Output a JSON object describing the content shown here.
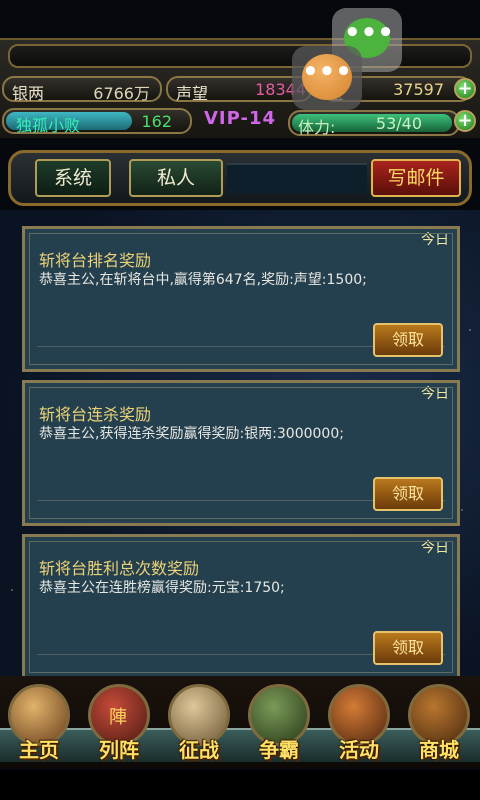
{
  "stats": {
    "silver": {
      "label": "银两",
      "value": "6766万"
    },
    "fame": {
      "label": "声望",
      "value": "18344"
    },
    "gold": {
      "label": "宝",
      "value": "37597"
    },
    "player": {
      "name": "独孤小败",
      "level": "162"
    },
    "vip": "VIP-14",
    "stamina": {
      "label": "体力:",
      "value": "53/40"
    }
  },
  "tabs": {
    "system": "系统",
    "private": "私人",
    "write": "写邮件"
  },
  "mails": [
    {
      "date": "今日",
      "title": "斩将台排名奖励",
      "body": "恭喜主公,在斩将台中,赢得第647名,奖励:声望:1500;",
      "button": "领取"
    },
    {
      "date": "今日",
      "title": "斩将台连杀奖励",
      "body": "恭喜主公,获得连杀奖励赢得奖励:银两:3000000;",
      "button": "领取"
    },
    {
      "date": "今日",
      "title": "斩将台胜利总次数奖励",
      "body": "恭喜主公在连胜榜赢得奖励:元宝:1750;",
      "button": "领取"
    }
  ],
  "nav": [
    {
      "label": "主页",
      "icon": "palace-icon"
    },
    {
      "label": "列阵",
      "icon": "banner-icon",
      "icon_text": "陣"
    },
    {
      "label": "征战",
      "icon": "map-scroll-icon"
    },
    {
      "label": "争霸",
      "icon": "crossed-axes-icon"
    },
    {
      "label": "活动",
      "icon": "lantern-icon"
    },
    {
      "label": "商城",
      "icon": "treasure-chest-icon"
    }
  ],
  "chat": {
    "green_icon": "message-icon",
    "orange_icon": "more-icon",
    "green_glyph": "•••",
    "orange_glyph": "•••"
  },
  "colors": {
    "accent_gold": "#ecd277",
    "fame": "#e65aa3",
    "vip": "#d066e8",
    "plus": "#3fa836"
  }
}
